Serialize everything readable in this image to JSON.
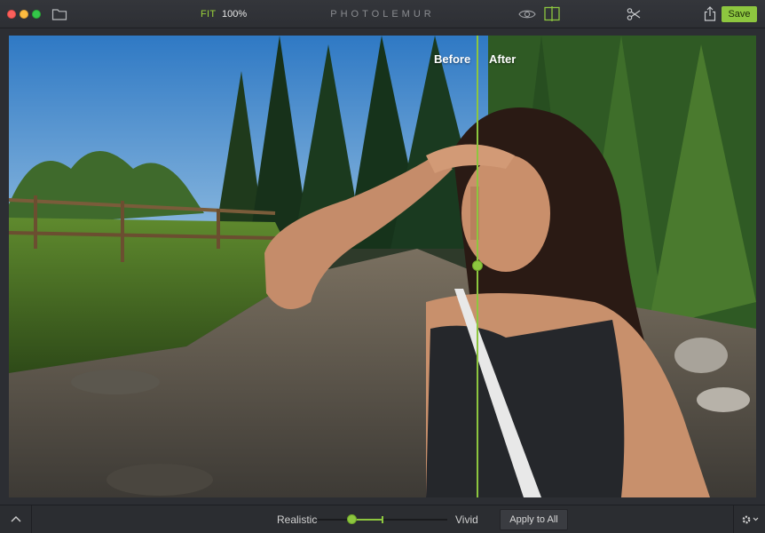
{
  "toolbar": {
    "zoom_fit_label": "FIT",
    "zoom_percent": "100%",
    "app_title": "PHOTOLEMUR",
    "save_label": "Save"
  },
  "preview": {
    "before_label": "Before",
    "after_label": "After"
  },
  "bottom": {
    "left_label": "Realistic",
    "right_label": "Vivid",
    "strength_value": 0.27,
    "apply_label": "Apply to All"
  },
  "colors": {
    "accent": "#8dc63f",
    "toolbar_bg": "#2d2f34",
    "close": "#fc605c",
    "minimize": "#fdbc40",
    "maximize": "#34c84a"
  },
  "icons": [
    "folder-icon",
    "eye-icon",
    "split-view-icon",
    "scissors-icon",
    "share-icon",
    "chevron-up-icon",
    "gear-icon"
  ]
}
